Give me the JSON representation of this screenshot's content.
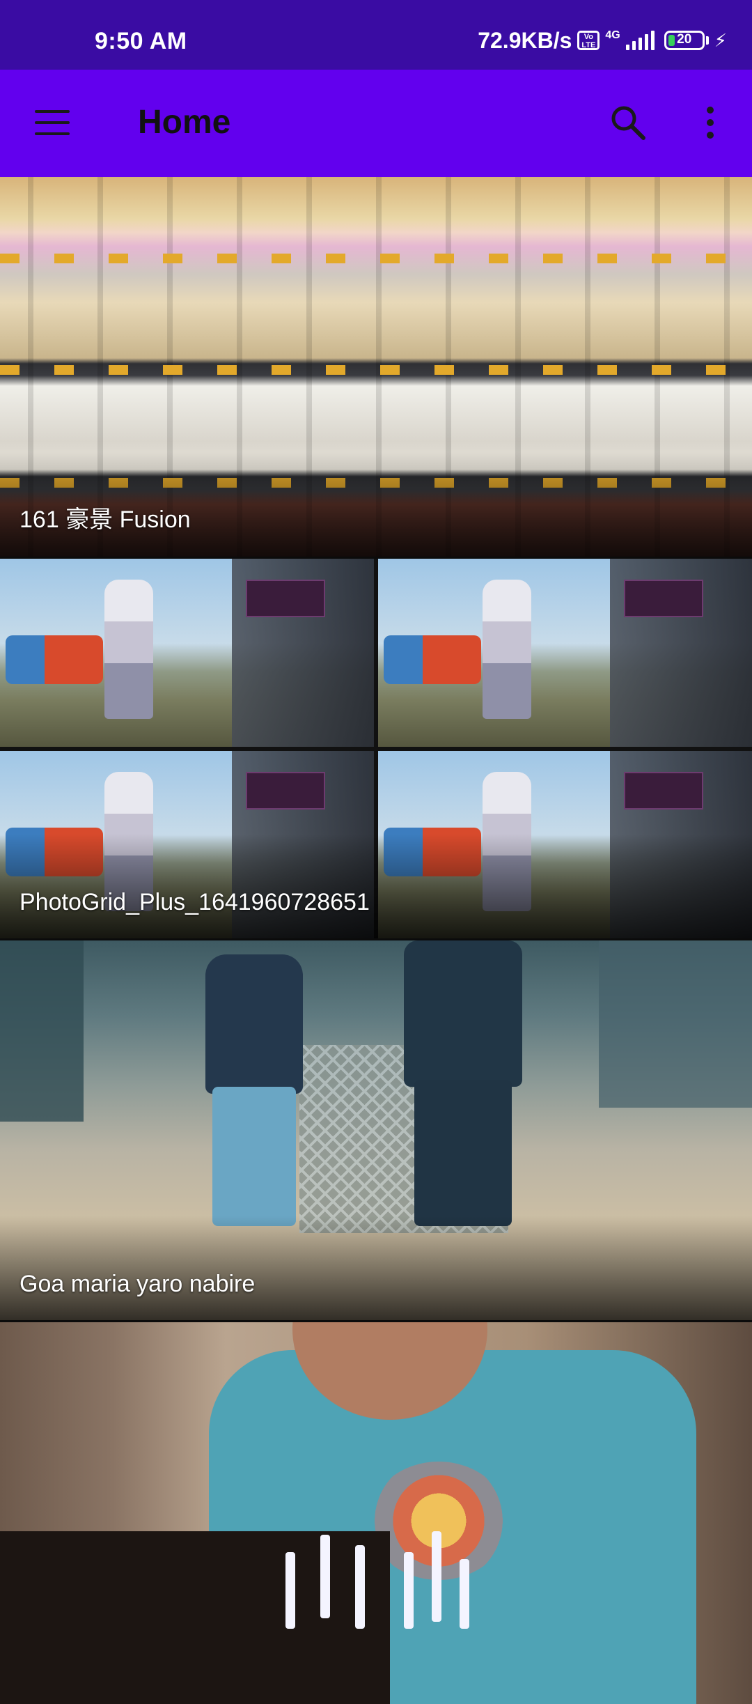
{
  "status_bar": {
    "time": "9:50 AM",
    "network_speed": "72.9KB/s",
    "volte_label": "Vo LTE",
    "network_type": "4G",
    "battery_level": "20",
    "battery_percent": 20,
    "charging": true
  },
  "app_bar": {
    "title": "Home",
    "menu_icon": "hamburger-menu-icon",
    "search_icon": "search-icon",
    "more_icon": "more-vertical-icon"
  },
  "albums": [
    {
      "name": "161 豪景 Fusion"
    },
    {
      "name": "PhotoGrid_Plus_1641960728651"
    },
    {
      "name": "Goa maria yaro nabire"
    },
    {
      "name": ""
    }
  ],
  "colors": {
    "status_bar": "#3a0ca3",
    "app_bar": "#6200ee",
    "title_text": "#111111"
  }
}
